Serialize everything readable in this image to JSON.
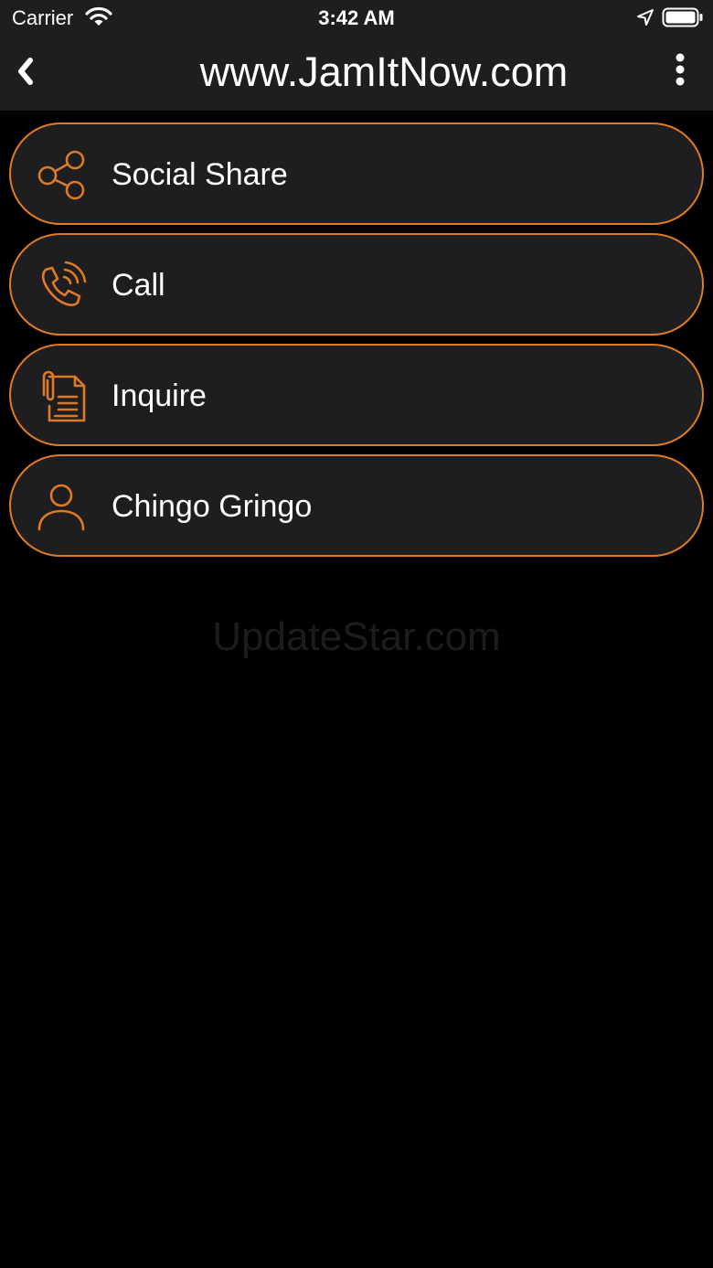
{
  "status_bar": {
    "carrier": "Carrier",
    "time": "3:42 AM",
    "icons": [
      "wifi-icon",
      "location-arrow-icon",
      "battery-icon"
    ]
  },
  "navbar": {
    "title": "www.JamItNow.com",
    "back_icon": "chevron-left-icon",
    "more_icon": "vertical-ellipsis-icon"
  },
  "menu": {
    "items": [
      {
        "label": "Social Share",
        "icon": "share-icon"
      },
      {
        "label": "Call",
        "icon": "phone-icon"
      },
      {
        "label": "Inquire",
        "icon": "document-clip-icon"
      },
      {
        "label": "Chingo Gringo",
        "icon": "person-icon"
      }
    ]
  },
  "watermark": "UpdateStar.com",
  "colors": {
    "accent": "#e07b24",
    "bar_background": "#1e1e20",
    "page_background": "#000000",
    "text": "#ffffff"
  }
}
